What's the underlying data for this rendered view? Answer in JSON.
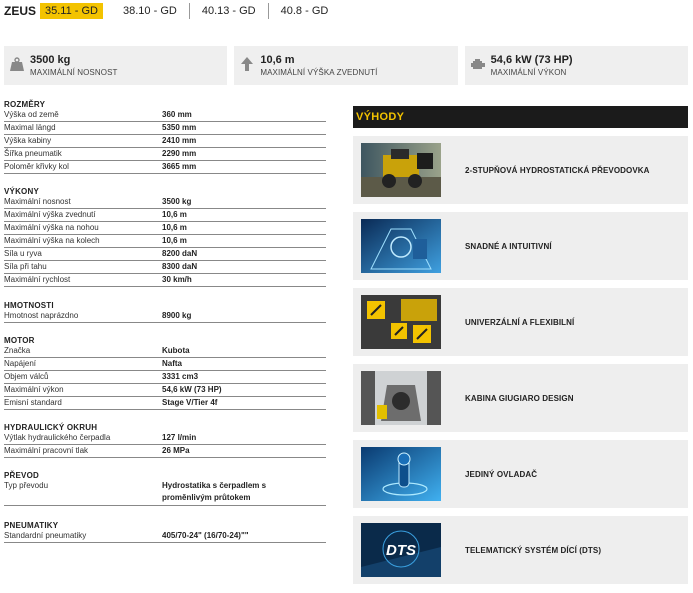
{
  "brand": "ZEUS",
  "models": [
    {
      "label": "35.11 - GD",
      "active": true
    },
    {
      "label": "38.10 - GD",
      "active": false
    },
    {
      "label": "40.13 - GD",
      "active": false
    },
    {
      "label": "40.8 - GD",
      "active": false
    }
  ],
  "stats": [
    {
      "icon": "weight-icon",
      "value": "3500 kg",
      "label": "MAXIMÁLNÍ NOSNOST"
    },
    {
      "icon": "arrow-up-icon",
      "value": "10,6 m",
      "label": "MAXIMÁLNÍ VÝŠKA ZVEDNUTÍ"
    },
    {
      "icon": "engine-icon",
      "value": "54,6 kW (73 HP)",
      "label": "MAXIMÁLNÍ VÝKON"
    }
  ],
  "sections": [
    {
      "title": "ROZMĚRY",
      "rows": [
        [
          "Výška od země",
          "360 mm"
        ],
        [
          "Maximal längd",
          "5350 mm"
        ],
        [
          "Výška kabiny",
          "2410 mm"
        ],
        [
          "Šířka pneumatik",
          "2290 mm"
        ],
        [
          "Poloměr křivky kol",
          "3665 mm"
        ]
      ]
    },
    {
      "title": "VÝKONY",
      "rows": [
        [
          "Maximální nosnost",
          "3500 kg"
        ],
        [
          "Maximální výška zvednutí",
          "10,6 m"
        ],
        [
          "Maximální výška na nohou",
          "10,6 m"
        ],
        [
          "Maximální výška na kolech",
          "10,6 m"
        ],
        [
          "Síla u ryva",
          "8200 daN"
        ],
        [
          "Síla při tahu",
          "8300 daN"
        ],
        [
          "Maximální rychlost",
          "30 km/h"
        ]
      ]
    },
    {
      "title": "HMOTNOSTI",
      "rows": [
        [
          "Hmotnost naprázdno",
          "8900 kg"
        ]
      ]
    },
    {
      "title": "MOTOR",
      "rows": [
        [
          "Značka",
          "Kubota"
        ],
        [
          "Napájení",
          "Nafta"
        ],
        [
          "Objem válců",
          "3331 cm3"
        ],
        [
          "Maximální výkon",
          "54,6 kW (73 HP)"
        ],
        [
          "Emisní standard",
          "Stage V/Tier 4f"
        ]
      ]
    },
    {
      "title": "HYDRAULICKÝ OKRUH",
      "rows": [
        [
          "Výtlak hydraulického čerpadla",
          "127 l/min"
        ],
        [
          "Maximální pracovní tlak",
          "26 MPa"
        ]
      ]
    },
    {
      "title": "PŘEVOD",
      "rows": [
        [
          "Typ převodu",
          "Hydrostatika s čerpadlem s proměnlivým průtokem"
        ]
      ]
    },
    {
      "title": "PNEUMATIKY",
      "rows": [
        [
          "Standardní pneumatiky",
          "405/70-24\" (16/70-24)\"\""
        ]
      ]
    }
  ],
  "benefits": {
    "title": "VÝHODY",
    "items": [
      {
        "label": "2-STUPŇOVÁ HYDROSTATICKÁ PŘEVODOVKA",
        "thumb": "gearbox"
      },
      {
        "label": "SNADNÉ A INTUITIVNÍ",
        "thumb": "cab-blue"
      },
      {
        "label": "UNIVERZÁLNÍ A FLEXIBILNÍ",
        "thumb": "attachments"
      },
      {
        "label": "KABINA GIUGIARO DESIGN",
        "thumb": "cabin"
      },
      {
        "label": "JEDINÝ OVLADAČ",
        "thumb": "joystick"
      },
      {
        "label": "TELEMATICKÝ SYSTÉM DÍCÍ (DTS)",
        "thumb": "dts"
      }
    ],
    "dts_logo": "DTS"
  },
  "colors": {
    "accent": "#f3c300",
    "dark": "#1b1b1b",
    "panel": "#efefef"
  }
}
